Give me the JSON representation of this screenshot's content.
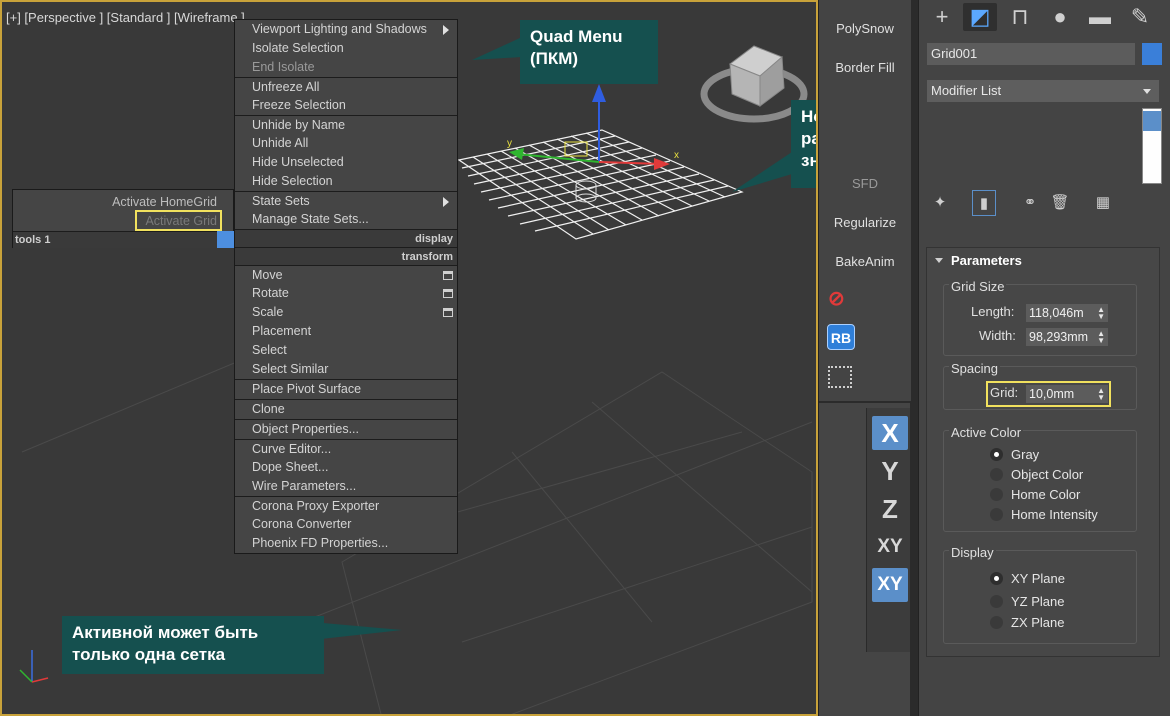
{
  "viewport": {
    "label": "[+] [Perspective ] [Standard ] [Wireframe ]"
  },
  "quad_menu": {
    "sections": [
      [
        {
          "label": "Viewport Lighting and Shadows",
          "sub": true
        },
        {
          "label": "Isolate Selection"
        },
        {
          "label": "End Isolate",
          "dim": true
        }
      ],
      [
        {
          "label": "Unfreeze All"
        },
        {
          "label": "Freeze Selection"
        }
      ],
      [
        {
          "label": "Unhide by Name"
        },
        {
          "label": "Unhide All"
        },
        {
          "label": "Hide Unselected"
        },
        {
          "label": "Hide Selection"
        }
      ],
      [
        {
          "label": "State Sets",
          "sub": true
        },
        {
          "label": "Manage State Sets..."
        }
      ]
    ],
    "display_header": "display",
    "transform_header": "transform",
    "transform_sections": [
      [
        {
          "label": "Move",
          "box": true
        },
        {
          "label": "Rotate",
          "box": true
        },
        {
          "label": "Scale",
          "box": true
        },
        {
          "label": "Placement"
        },
        {
          "label": "Select"
        },
        {
          "label": "Select Similar"
        }
      ],
      [
        {
          "label": "Place Pivot Surface"
        }
      ],
      [
        {
          "label": "Clone"
        }
      ],
      [
        {
          "label": "Object Properties..."
        }
      ],
      [
        {
          "label": "Curve Editor..."
        },
        {
          "label": "Dope Sheet..."
        },
        {
          "label": "Wire Parameters..."
        }
      ],
      [
        {
          "label": "Corona Proxy Exporter"
        },
        {
          "label": "Corona Converter"
        },
        {
          "label": "Phoenix FD Properties..."
        }
      ]
    ],
    "left_items": [
      "Activate HomeGrid",
      "Activate Grid"
    ],
    "tools_header": "tools 1"
  },
  "callouts": {
    "quad_menu": [
      "Quad Menu",
      "(ПКМ)"
    ],
    "new_grid": [
      "Новая сетка активна и",
      "разделена на части по",
      "значению Grid"
    ],
    "one_grid": [
      "Активной может быть",
      "только одна сетка"
    ]
  },
  "midbar": {
    "buttons": [
      "PolySnow",
      "Border Fill",
      "SFD",
      "Regularize",
      "BakeAnim"
    ],
    "rb_label": "RB",
    "axes": [
      "X",
      "Y",
      "Z",
      "XY",
      "XY"
    ]
  },
  "panel": {
    "object_name": "Grid001",
    "modifier_list": "Modifier List",
    "accent_color": "#3a7fd9",
    "parameters_title": "Parameters",
    "grid_size": {
      "title": "Grid Size",
      "length_label": "Length:",
      "length_value": "118,046m",
      "width_label": "Width:",
      "width_value": "98,293mm"
    },
    "spacing": {
      "title": "Spacing",
      "grid_label": "Grid:",
      "grid_value": "10,0mm"
    },
    "active_color": {
      "title": "Active Color",
      "options": [
        "Gray",
        "Object Color",
        "Home Color",
        "Home Intensity"
      ],
      "selected": "Gray"
    },
    "display": {
      "title": "Display",
      "options": [
        "XY Plane",
        "YZ Plane",
        "ZX Plane"
      ],
      "selected": "XY Plane"
    }
  }
}
